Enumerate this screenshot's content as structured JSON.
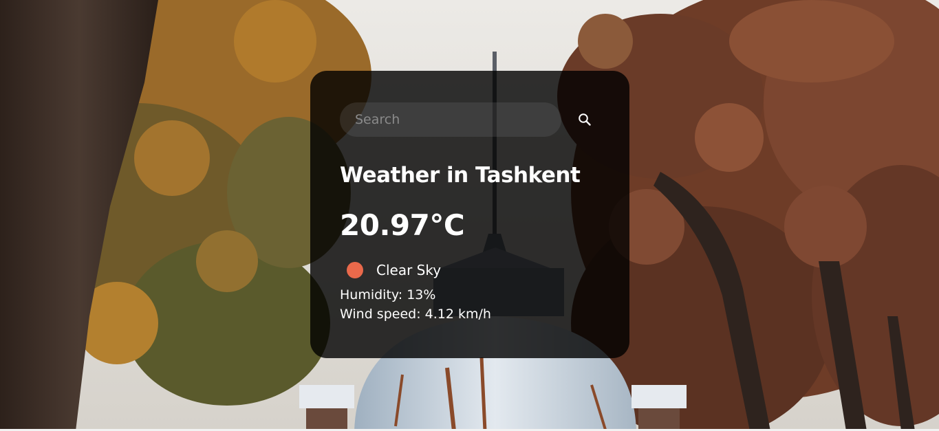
{
  "search": {
    "placeholder": "Search",
    "value": ""
  },
  "weather": {
    "title": "Weather in Tashkent",
    "temperature": "20.97°C",
    "description": "Clear Sky",
    "humidity": "Humidity: 13%",
    "wind": "Wind speed: 4.12 km/h"
  },
  "icons": {
    "search": "search-icon",
    "weather": "clear-sky-icon"
  },
  "colors": {
    "card_background": "#000000cc",
    "text": "#ffffff",
    "weather_icon": "#e9694b"
  }
}
